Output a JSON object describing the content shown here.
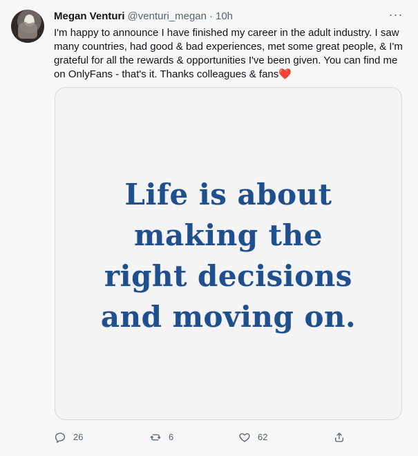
{
  "tweet": {
    "author": {
      "name": "Megan Venturi",
      "handle": "@venturi_megan",
      "time": "10h"
    },
    "text": "I'm happy to announce I have finished my career in the adult industry. I saw many countries, had good & bad experiences, met some great people, & I'm grateful for all the rewards & opportunities I've been given. You can find me on OnlyFans - that's it. Thanks colleagues & fans❤️",
    "media": {
      "lines": [
        "Life is about",
        "making the",
        "right decisions",
        "and moving on."
      ]
    },
    "actions": {
      "reply_count": "26",
      "retweet_count": "6",
      "like_count": "62"
    },
    "more_icon": "more-icon",
    "colors": {
      "background": "#f7f7f7",
      "border": "#cfd9de",
      "muted": "#536471",
      "image_text": "#1f4f8d"
    }
  }
}
